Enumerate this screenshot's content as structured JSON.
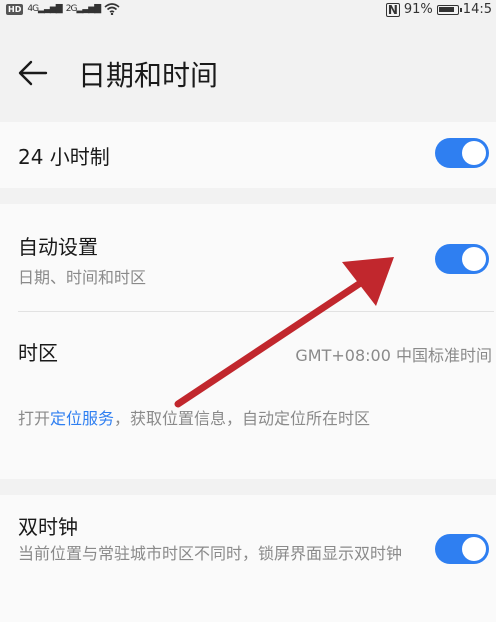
{
  "status_bar": {
    "hd_badge": "HD",
    "signal1_label": "4G",
    "signal2_label": "2G",
    "battery_percent": "91%",
    "battery_level": 0.91,
    "time": "14:5"
  },
  "header": {
    "title": "日期和时间"
  },
  "settings": {
    "hour24": {
      "label": "24 小时制",
      "enabled": true
    },
    "auto_set": {
      "label": "自动设置",
      "sublabel": "日期、时间和时区",
      "enabled": true
    },
    "timezone": {
      "label": "时区",
      "value": "GMT+08:00 中国标准时间"
    },
    "location_hint": {
      "prefix": "打开",
      "link": "定位服务",
      "suffix": "，获取位置信息，自动定位所在时区"
    },
    "dual_clock": {
      "label": "双时钟",
      "sublabel": "当前位置与常驻城市时区不同时，锁屏界面显示双时钟",
      "enabled": true
    }
  },
  "colors": {
    "accent": "#2f7ff1",
    "annotation_arrow": "#c1272d"
  },
  "icons": {
    "back": "back-arrow-icon",
    "wifi": "wifi-icon",
    "nfc": "nfc-icon",
    "battery": "battery-icon"
  }
}
